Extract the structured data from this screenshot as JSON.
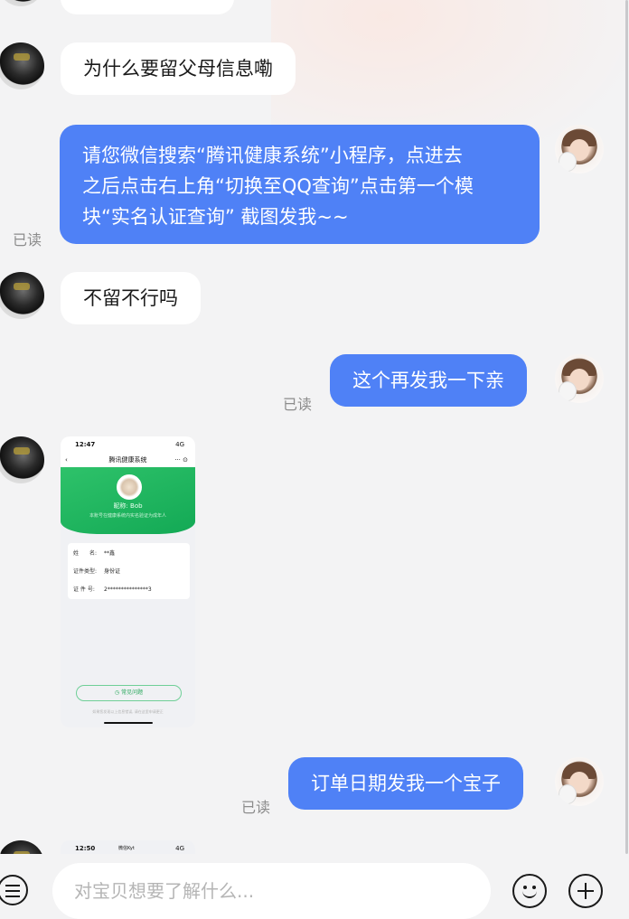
{
  "messages": [
    {
      "side": "left",
      "text": "为什么要留父母信息嘞"
    },
    {
      "side": "right",
      "lines": [
        "请您微信搜索“腾讯健康系统”小程序，点进去",
        "之后点击右上角“切换至QQ查询”点击第一个模",
        "块“实名认证查询” 截图发我~~"
      ],
      "status": "已读"
    },
    {
      "side": "left",
      "text": "不留不行吗"
    },
    {
      "side": "right",
      "text": "这个再发我一下亲",
      "status": "已读"
    },
    {
      "side": "left",
      "type": "image",
      "screenshot": {
        "time": "12:47",
        "signal": "4G",
        "title": "腾讯健康系统",
        "nickname": "昵称: Bob",
        "subtitle": "本账号在健康系统内实名验证为成年人",
        "fields": [
          {
            "label": "姓　　名:",
            "value": "**鑫"
          },
          {
            "label": "证件类型:",
            "value": "身份证"
          },
          {
            "label": "证 件 号:",
            "value": "2***************3"
          }
        ],
        "faq": "常见问题",
        "footer": "如果您发现以上信息错误, 请在这里申请更正"
      }
    },
    {
      "side": "right",
      "text": "订单日期发我一个宝子",
      "status": "已读"
    },
    {
      "side": "left",
      "type": "image",
      "screenshot": {
        "time": "12:50",
        "middle": "微信Kyt",
        "signal": "4G"
      }
    }
  ],
  "input": {
    "placeholder": "对宝贝想要了解什么..."
  },
  "icons": {
    "menu": "menu-icon",
    "emoji": "emoji-icon",
    "plus": "plus-icon"
  },
  "colors": {
    "right_bubble": "#4f81f6",
    "left_bubble": "#ffffff",
    "background": "#f3f3f4",
    "green": "#1db45d"
  }
}
